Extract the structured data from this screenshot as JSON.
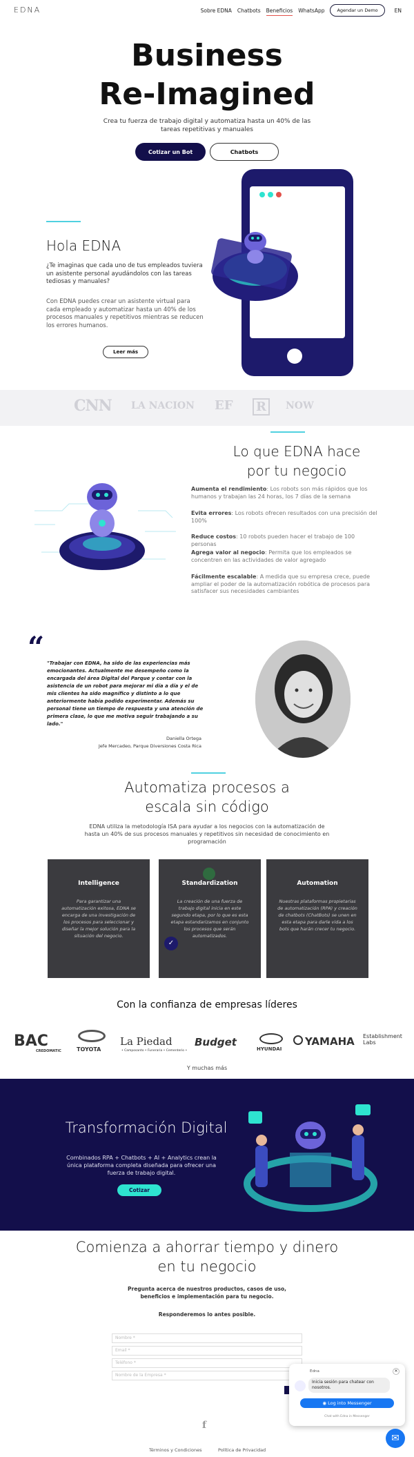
{
  "header": {
    "logo": "EDNA",
    "nav": [
      "Sobre EDNA",
      "Chatbots",
      "Beneficios",
      "WhatsApp"
    ],
    "cta": "Agendar un Demo",
    "lang": "EN"
  },
  "hero": {
    "title_line1": "Business",
    "title_line2": "Re-Imagined",
    "subtitle": "Crea tu fuerza de trabajo digital y automatiza hasta un 40% de las tareas repetitivas y manuales",
    "btn_primary": "Cotizar un Bot",
    "btn_secondary": "Chatbots"
  },
  "hola": {
    "title": "Hola EDNA",
    "question": "¿Te imaginas que cada uno de tus empleados tuviera un asistente personal ayudándolos con las tareas tediosas y manuales?",
    "body": "Con EDNA puedes crear un asistente virtual para cada empleado y automatizar hasta un 40% de los procesos manuales y repetitivos mientras se reducen los errores humanos.",
    "btn": "Leer más"
  },
  "media": [
    "CNN",
    "LA NACION",
    "EF",
    "R",
    "NOW"
  ],
  "benefits": {
    "title_line1": "Lo que EDNA hace",
    "title_line2": "por tu negocio",
    "items": [
      {
        "label": "Aumenta el rendimiento",
        "text": ": Los robots son más rápidos que los humanos y trabajan las 24 horas, los 7 días de la semana"
      },
      {
        "label": "Evita errores",
        "text": ": Los robots ofrecen resultados con una precisión del 100%"
      },
      {
        "label": "Reduce costos",
        "text": ": 10 robots pueden hacer el trabajo de 100 personas"
      },
      {
        "label": "Agrega valor al negocio",
        "text": ": Permita que los empleados se concentren en las actividades de valor agregado"
      },
      {
        "label": "Fácilmente escalable",
        "text": ": A medida que su empresa crece, puede ampliar el poder de la automatización robótica de procesos para satisfacer sus necesidades cambiantes"
      }
    ]
  },
  "testimonial": {
    "quote_mark": "“",
    "quote": "\"Trabajar con EDNA, ha sido de las experiencias más emocionantes. Actualmente me desempeño como la encargada del área Digital del Parque y contar con la asistencia de un robot para mejorar mi día a día y el de mis clientes ha sido magnífico y distinto a lo que anteriormente había podido experimentar. Además su personal tiene un tiempo de respuesta y una atención de primera clase, lo que me motiva seguir trabajando a su lado.\"",
    "name": "Daniella Ortega",
    "role": "Jefe Mercadeo, Parque Diversiones Costa Rica"
  },
  "automation": {
    "title_line1": "Automatiza procesos a",
    "title_line2": "escala sin código",
    "body": "EDNA utiliza la metodología ISA para ayudar a los negocios con la automatización de hasta un 40% de sus procesos manuales y repetitivos sin necesidad de conocimiento en programación",
    "cards": [
      {
        "title": "Intelligence",
        "text": "Para garantizar una automatización exitosa, EDNA se encarga de una investigación de los procesos para seleccionar y diseñar la mejor solución para la situación del negocio."
      },
      {
        "title": "Standardization",
        "text": "La creación de una fuerza de trabajo digital inicia en este segundo etapa, por lo que es esta etapa estandarizamos en conjunto los procesos que serán automatizados."
      },
      {
        "title": "Automation",
        "text": "Nuestras plataformas propietarias de automatización (RPA) y creación de chatbots (ChatBots) se unen en esta etapa para darle vida a los bots que harán crecer tu negocio."
      }
    ]
  },
  "clients": {
    "title": "Con la confianza de empresas líderes",
    "logos": [
      "BAC",
      "TOYOTA",
      "La Piedad",
      "Budget",
      "HYUNDAI",
      "YAMAHA",
      "Establishment Labs"
    ],
    "bac_sub": "CREDOMATIC",
    "lapiedad_sub": "• Camposanto • Funeraria • Cementerio •",
    "more": "Y muchas más"
  },
  "digital": {
    "title": "Transformación Digital",
    "body": "Combinados RPA + Chatbots + AI + Analytics crean la única plataforma completa diseñada para ofrecer una fuerza de trabajo digital.",
    "btn": "Cotizar"
  },
  "contact": {
    "title_line1": "Comienza a ahorrar tiempo y dinero",
    "title_line2": "en tu negocio",
    "body": "Pregunta acerca de nuestros productos, casos de uso, beneficios e implementación para tu negocio.",
    "reply": "Responderemos lo antes posible.",
    "fields": [
      "Nombre *",
      "Email *",
      "Teléfono *",
      "Nombre de la Empresa *"
    ]
  },
  "chat": {
    "name": "Edna",
    "message": "Inicia sesión para chatear con nosotros.",
    "btn": "Log into Messenger",
    "sub": "Chat with Edna in Messenger"
  },
  "footer": {
    "links": [
      "Términos y Condiciones",
      "Política de Privacidad"
    ]
  },
  "colors": {
    "navy": "#130f4b",
    "accent": "#4fd1e0",
    "teal": "#2ee3d0"
  }
}
